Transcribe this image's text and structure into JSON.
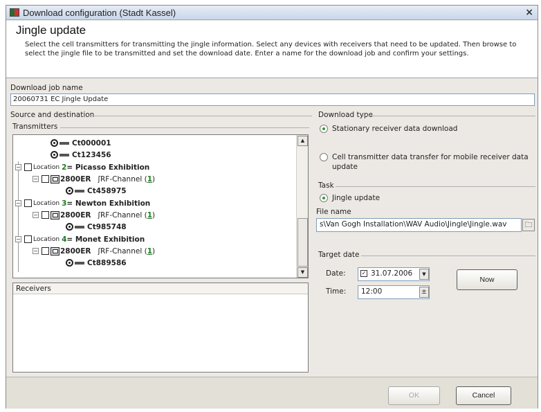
{
  "window": {
    "title": "Download configuration (Stadt Kassel)",
    "close_glyph": "×"
  },
  "header": {
    "title": "Jingle update",
    "description": "Select the cell transmitters for transmitting the jingle information. Select any devices with receivers that need to be updated. Then browse to select the jingle file to be transmitted and set the download date. Enter a name for the download job and confirm your settings."
  },
  "job": {
    "label": "Download job name",
    "value": "20060731 EC Jingle Update"
  },
  "source": {
    "group_label": "Source and destination",
    "transmitters_label": "Transmitters",
    "tree": [
      {
        "type": "transmitter",
        "code": "Ct000001"
      },
      {
        "type": "transmitter",
        "code": "Ct123456"
      },
      {
        "type": "location",
        "prefix": "Location",
        "num": "2",
        "name": "= Picasso Exhibition"
      },
      {
        "type": "device",
        "model": "2800ER",
        "channel": "RF-Channel (",
        "channel_num": "1",
        "channel_end": ")"
      },
      {
        "type": "transmitter",
        "code": "Ct458975"
      },
      {
        "type": "location",
        "prefix": "Location",
        "num": "3",
        "name": "= Newton Exhibition"
      },
      {
        "type": "device",
        "model": "2800ER",
        "channel": "RF-Channel (",
        "channel_num": "1",
        "channel_end": ")"
      },
      {
        "type": "transmitter",
        "code": "Ct985748"
      },
      {
        "type": "location",
        "prefix": "Location",
        "num": "4",
        "name": "= Monet Exhibition"
      },
      {
        "type": "device",
        "model": "2800ER",
        "channel": "RF-Channel (",
        "channel_num": "1",
        "channel_end": ")"
      },
      {
        "type": "transmitter",
        "code": "Ct889586"
      }
    ],
    "receivers_label": "Receivers"
  },
  "download_type": {
    "label": "Download type",
    "options": [
      {
        "label": "Stationary receiver data download",
        "selected": true
      },
      {
        "label": "Cell transmitter data transfer for mobile receiver data update",
        "selected": false
      }
    ]
  },
  "task": {
    "label": "Task",
    "option": "Jingle update",
    "file_label": "File name",
    "file_value": "s\\Van Gogh Installation\\WAV Audio\\Jingle\\Jingle.wav"
  },
  "target_date": {
    "label": "Target date",
    "date_label": "Date:",
    "date_value": "31.07.2006",
    "time_label": "Time:",
    "time_value": "12:00",
    "now_button": "Now"
  },
  "footer": {
    "ok_label": "OK",
    "cancel_label": "Cancel"
  },
  "colors": {
    "accent_green": "#1a7a1a",
    "radio_green": "#2a9d2a",
    "field_border": "#7f9db9"
  }
}
